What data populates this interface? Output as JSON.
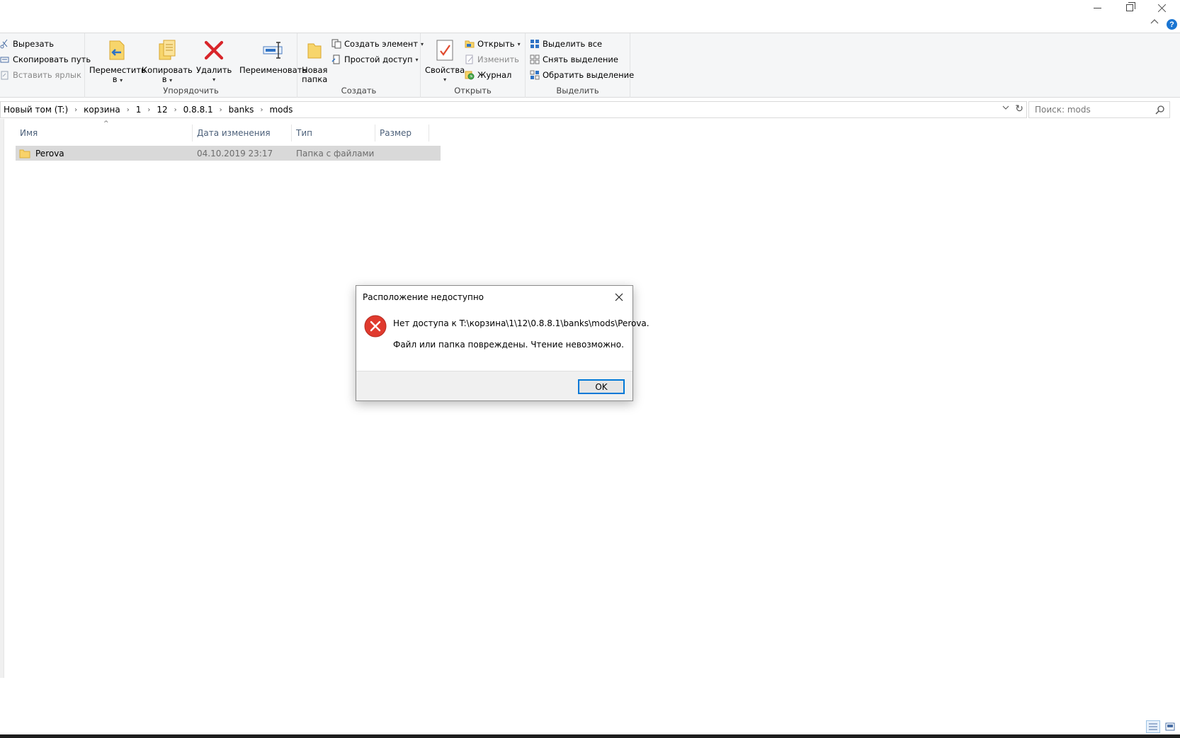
{
  "window": {
    "minimize_icon": "minimize-icon",
    "maximize_icon": "restore-icon",
    "close_icon": "close-icon"
  },
  "ribbon": {
    "clipboard": {
      "cut": "Вырезать",
      "copy_path": "Скопировать путь",
      "paste_shortcut": "Вставить ярлык"
    },
    "organize": {
      "label": "Упорядочить",
      "move_to_line1": "Переместить",
      "move_to_line2": "в",
      "copy_to_line1": "Копировать",
      "copy_to_line2": "в",
      "delete": "Удалить",
      "rename": "Переименовать"
    },
    "create": {
      "label": "Создать",
      "new_folder_line1": "Новая",
      "new_folder_line2": "папка",
      "new_item": "Создать элемент",
      "easy_access": "Простой доступ"
    },
    "open": {
      "label": "Открыть",
      "properties": "Свойства",
      "open": "Открыть",
      "edit": "Изменить",
      "history": "Журнал"
    },
    "select": {
      "label": "Выделить",
      "select_all": "Выделить все",
      "select_none": "Снять выделение",
      "invert_selection": "Обратить выделение"
    }
  },
  "address": {
    "crumbs": [
      "Новый том (T:)",
      "корзина",
      "1",
      "12",
      "0.8.8.1",
      "banks",
      "mods"
    ],
    "search_placeholder": "Поиск: mods"
  },
  "file_list": {
    "columns": [
      "Имя",
      "Дата изменения",
      "Тип",
      "Размер"
    ],
    "rows": [
      {
        "name": "Perova",
        "modified": "04.10.2019 23:17",
        "type": "Папка с файлами",
        "size": ""
      }
    ]
  },
  "dialog": {
    "title": "Расположение недоступно",
    "message1": "Нет доступа к T:\\корзина\\1\\12\\0.8.8.1\\banks\\mods\\Perova.",
    "message2": "Файл или папка повреждены. Чтение невозможно.",
    "ok_label": "OK"
  },
  "colors": {
    "accent": "#0078d7",
    "error_red": "#e03a2e",
    "selection": "#d9d9d9",
    "header_text": "#4c607a"
  }
}
